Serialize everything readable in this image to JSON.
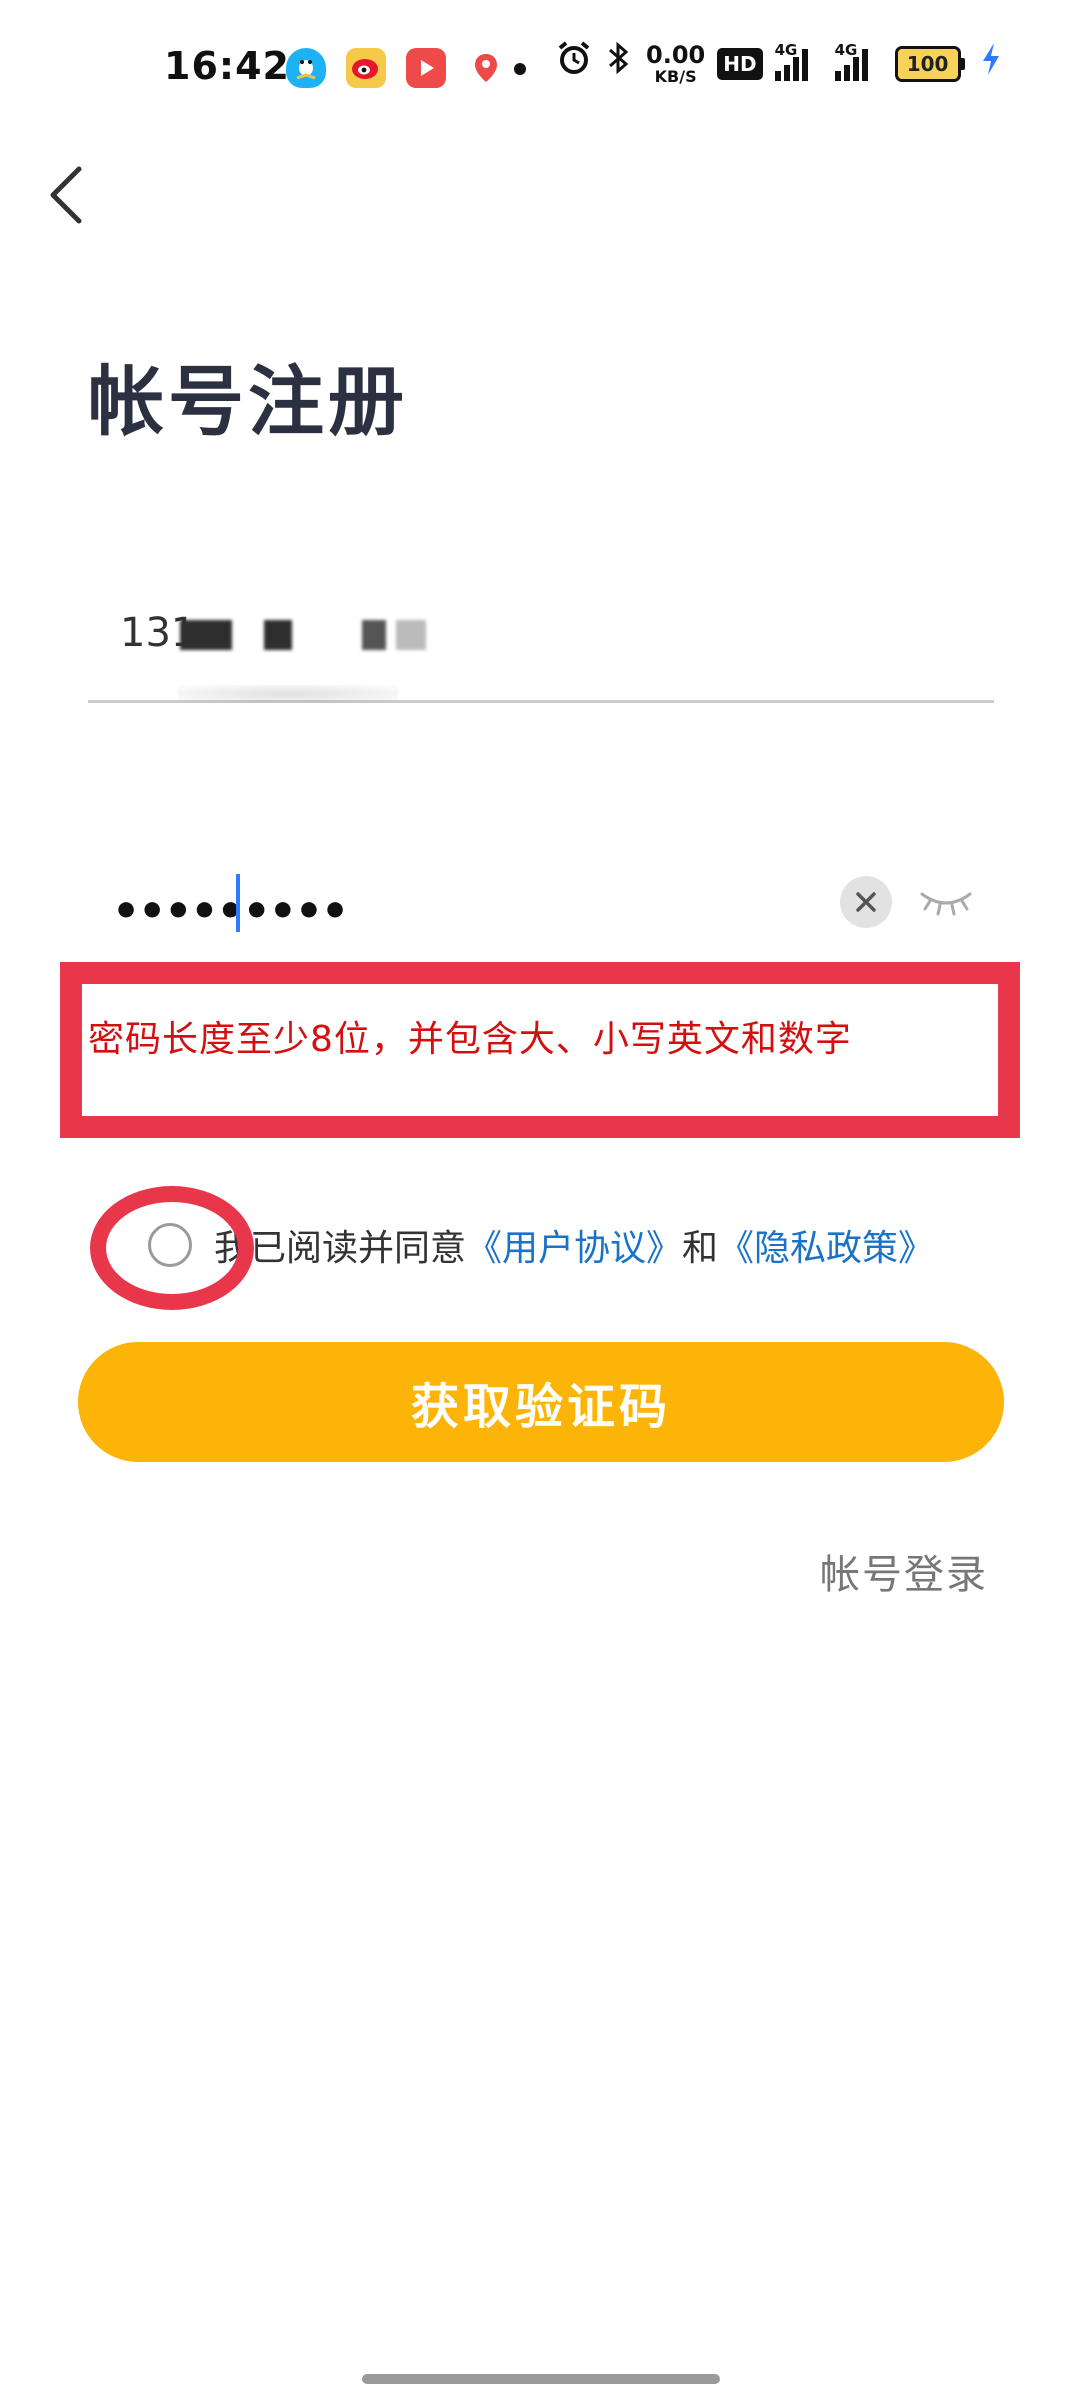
{
  "status_bar": {
    "time": "16:42",
    "net_speed_value": "0.00",
    "net_speed_unit": "KB/S",
    "hd_label": "HD",
    "signal_1_label": "4G",
    "signal_2_label": "4G",
    "battery_level": "100",
    "icons": [
      "qq-icon",
      "weibo-icon",
      "video-app-icon",
      "map-pin-icon",
      "alarm-icon",
      "bluetooth-icon",
      "charging-bolt-icon"
    ]
  },
  "header": {
    "title": "帐号注册"
  },
  "form": {
    "phone_value": "131",
    "password_value": "•••••••••",
    "error_message": "密码长度至少8位，并包含大、小写英文和数字"
  },
  "agreement": {
    "checked": false,
    "prefix": "我已阅读并同意",
    "user_agreement": "《用户协议》",
    "conjunction": "和",
    "privacy_policy": "《隐私政策》"
  },
  "actions": {
    "get_code_label": "获取验证码",
    "account_login_label": "帐号登录"
  },
  "colors": {
    "primary_button": "#fcb409",
    "link": "#1a73c9",
    "error_text": "#d40f0f",
    "annotation_red": "#e8364b",
    "title": "#2c3142"
  }
}
